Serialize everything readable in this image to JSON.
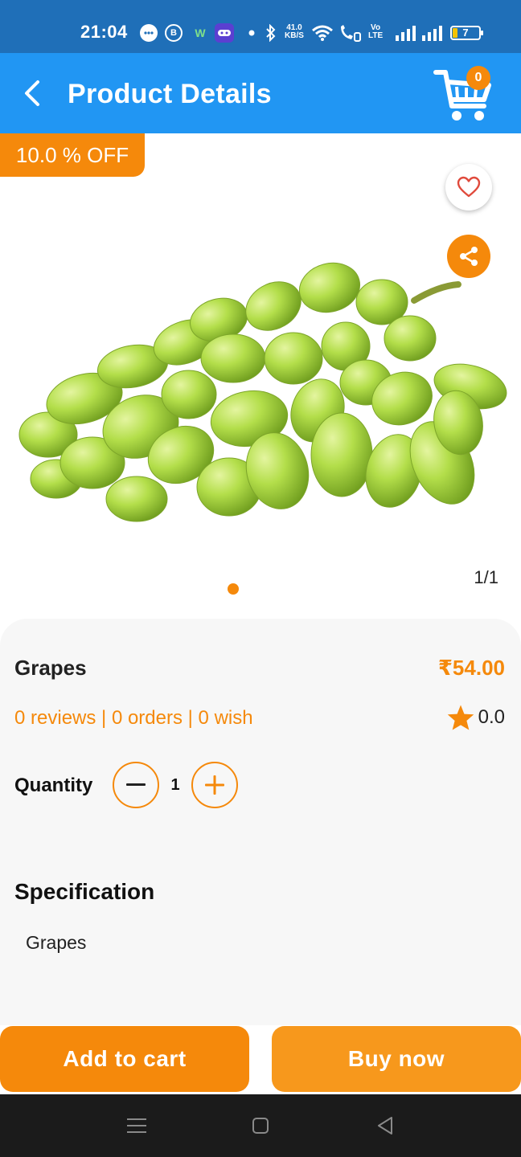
{
  "status_bar": {
    "time": "21:04",
    "notif_icons": [
      "chat-bubble-icon",
      "b-circle-icon",
      "w-app-icon",
      "game-app-icon",
      "dot-icon"
    ],
    "data_speed_value": "41.0",
    "data_speed_unit": "KB/S",
    "volte_label_top": "Vo",
    "volte_label_bottom": "LTE",
    "battery_level": "7",
    "colors": {
      "background": "#1f6fb8"
    }
  },
  "app_bar": {
    "title": "Product Details",
    "cart_count": "0",
    "colors": {
      "background": "#2196f3",
      "badge": "#f5890b"
    }
  },
  "gallery": {
    "discount": "10.0 % OFF",
    "image_counter": "1/1",
    "image_alt": "grapes",
    "page_dots": 1
  },
  "product": {
    "name": "Grapes",
    "price": "₹54.00",
    "meta": "0 reviews | 0 orders | 0 wish",
    "rating": "0.0",
    "quantity_label": "Quantity",
    "quantity_value": "1",
    "specification_title": "Specification",
    "specification_text": "Grapes"
  },
  "actions": {
    "add_to_cart": "Add to cart",
    "buy_now": "Buy now",
    "colors": {
      "accent": "#f5890b"
    }
  },
  "nav_bar": {
    "items": [
      "menu-icon",
      "home-square-icon",
      "back-triangle-icon"
    ]
  }
}
